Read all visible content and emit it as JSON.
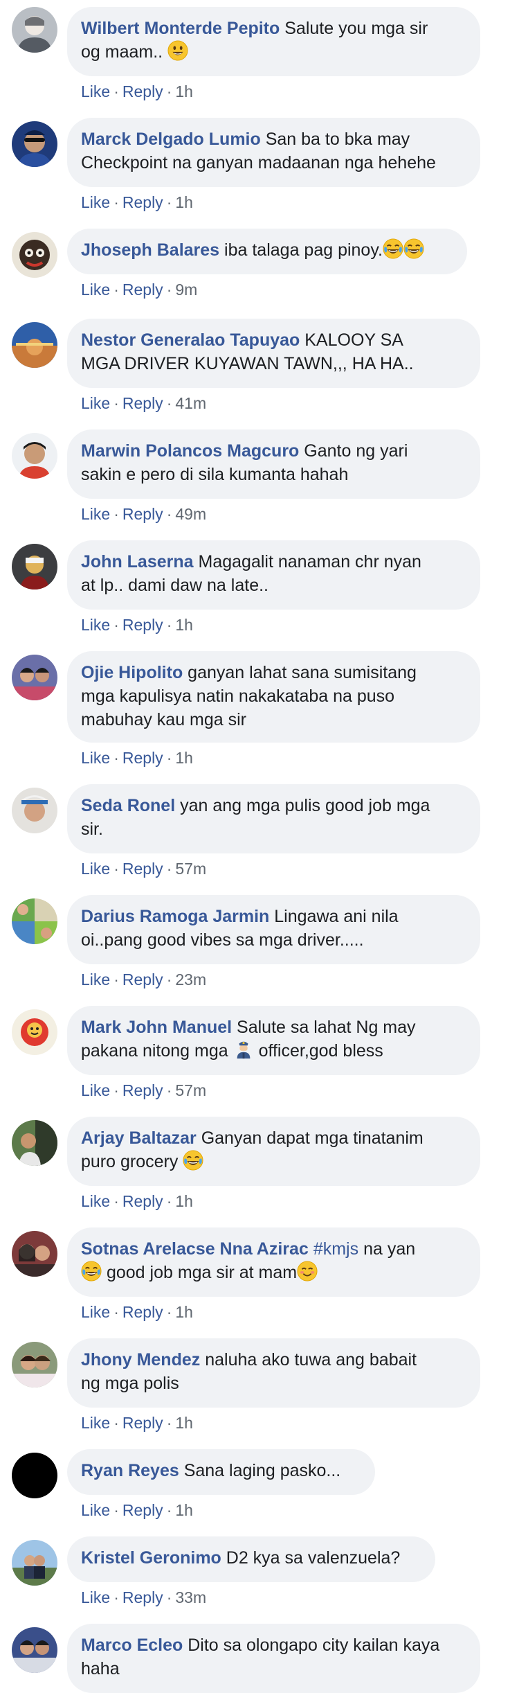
{
  "colors": {
    "author": "#385898",
    "bubble": "#f0f2f5",
    "meta": "#606770",
    "text": "#1c1e21"
  },
  "actions": {
    "like": "Like",
    "reply": "Reply"
  },
  "comments": [
    {
      "author": "Wilbert Monterde Pepito",
      "line1": "Salute you mga sir",
      "line2": "og maam..",
      "line2_emoji": "smiling-face-emoji",
      "time": "1h"
    },
    {
      "author": "Marck Delgado Lumio",
      "line1": "San ba to bka may",
      "line2": "Checkpoint na ganyan madaanan nga hehehe",
      "time": "1h"
    },
    {
      "author": "Jhoseph Balares",
      "line1": "iba talaga pag pinoy.",
      "line1_emoji": "tears-of-joy-emoji",
      "time": "9m"
    },
    {
      "author": "Nestor Generalao Tapuyao",
      "line1": "KALOOY SA",
      "line2": "MGA DRIVER KUYAWAN TAWN,,, HA HA..",
      "time": "41m"
    },
    {
      "author": "Marwin Polancos Magcuro",
      "line1": "Ganto ng yari",
      "line2": "sakin e pero di sila kumanta hahah",
      "time": "49m"
    },
    {
      "author": "John Laserna",
      "line1": "Magagalit nanaman chr nyan",
      "line2": "at lp.. dami daw na late..",
      "time": "1h"
    },
    {
      "author": "Ojie Hipolito",
      "line1": "ganyan lahat sana sumisitang",
      "line2": "mga kapulisya natin nakakataba na puso",
      "line3": "mabuhay kau mga sir",
      "time": "1h"
    },
    {
      "author": "Seda Ronel",
      "line1": "yan ang mga pulis good job mga",
      "line2": "sir.",
      "time": "57m"
    },
    {
      "author": "Darius Ramoga Jarmin",
      "line1": "Lingawa ani nila",
      "line2": "oi..pang good vibes sa mga driver.....",
      "time": "23m"
    },
    {
      "author": "Mark John Manuel",
      "line1": "Salute sa lahat Ng may",
      "line2a": "pakana nitong mga",
      "line2_emoji": "police-officer-emoji",
      "line2b": "officer,god bless",
      "time": "57m"
    },
    {
      "author": "Arjay Baltazar",
      "line1": "Ganyan dapat mga tinatanim",
      "line2": "puro grocery",
      "line2_emoji": "tears-of-joy-emoji",
      "time": "1h"
    },
    {
      "author": "Sotnas Arelacse Nna Azirac",
      "hashtag": "#kmjs",
      "line1": "na yan",
      "line2": "good job mga sir at mam",
      "line2_emoji_before": "tears-of-joy-emoji",
      "line2_emoji_after": "smiling-eyes-emoji",
      "time": "1h"
    },
    {
      "author": "Jhony Mendez",
      "line1": "naluha ako tuwa ang babait",
      "line2": "ng mga polis",
      "time": "1h"
    },
    {
      "author": "Ryan Reyes",
      "line1": "Sana laging pasko...",
      "time": "1h"
    },
    {
      "author": "Kristel Geronimo",
      "line1": "D2 kya sa valenzuela?",
      "time": "33m"
    },
    {
      "author": "Marco Ecleo",
      "line1": "Dito sa olongapo city kailan kaya",
      "line2": "haha"
    }
  ]
}
